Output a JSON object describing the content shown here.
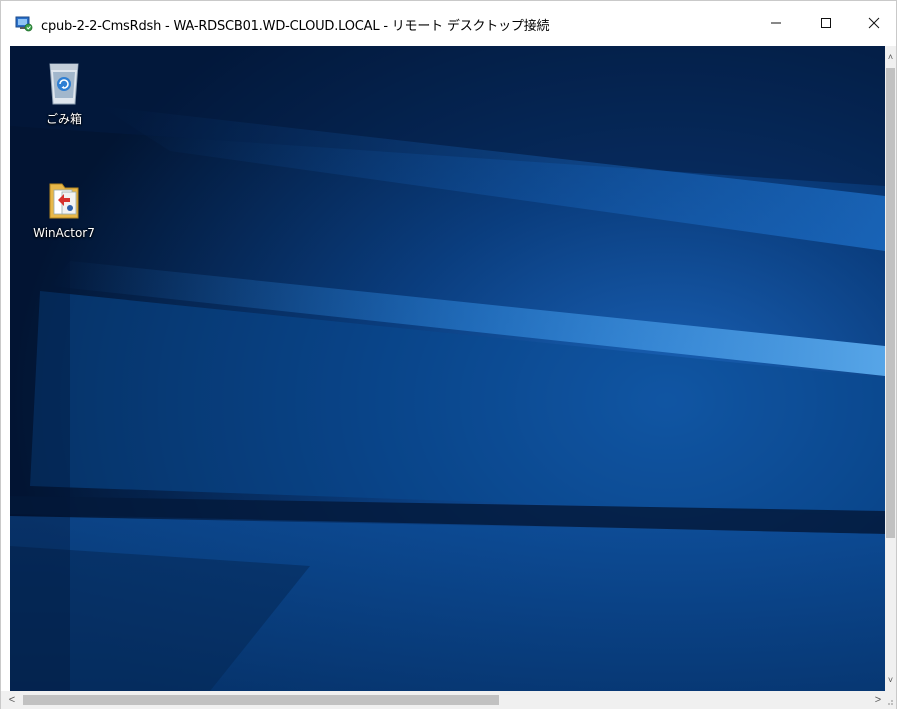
{
  "window": {
    "title": "cpub-2-2-CmsRdsh - WA-RDSCB01.WD-CLOUD.LOCAL - リモート デスクトップ接続",
    "app_icon": "remote-desktop-icon",
    "controls": {
      "minimize": "—",
      "maximize": "☐",
      "close": "✕"
    }
  },
  "desktop": {
    "wallpaper": "windows-10-hero-blue",
    "colors": {
      "dark": "#031a3a",
      "mid": "#0b4a92",
      "light": "#2a8ce0"
    },
    "icons": [
      {
        "label": "ごみ箱",
        "icon": "recycle-bin-icon"
      },
      {
        "label": "WinActor7",
        "icon": "winactor-folder-icon"
      }
    ]
  },
  "scrollbars": {
    "up": "˄",
    "down": "˅",
    "left": "<",
    "right": ">"
  }
}
